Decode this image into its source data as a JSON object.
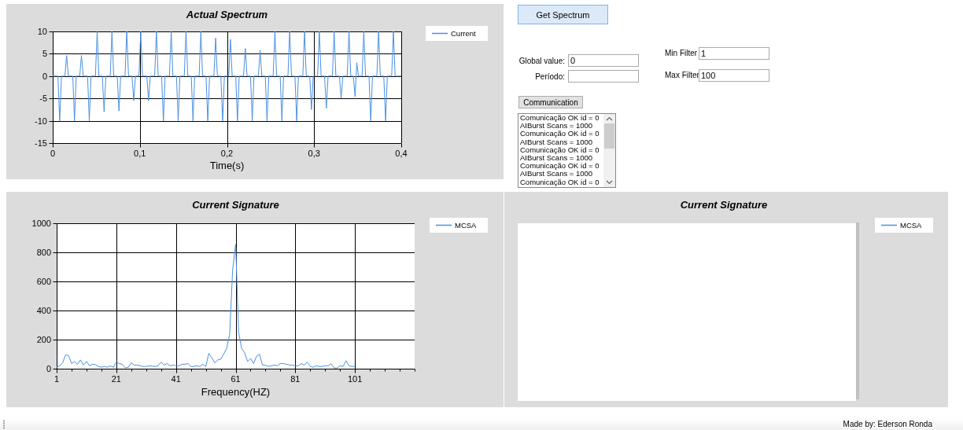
{
  "spectrum_chart": {
    "chart_data": {
      "type": "line",
      "title": "Actual Spectrum",
      "xlabel": "Time(s)",
      "x": [
        0,
        0.006,
        0.008,
        0.01,
        0.014,
        0.016,
        0.018,
        0.023,
        0.025,
        0.027,
        0.031,
        0.033,
        0.035,
        0.04,
        0.042,
        0.044,
        0.049,
        0.051,
        0.053,
        0.057,
        0.059,
        0.061,
        0.066,
        0.068,
        0.07,
        0.074,
        0.076,
        0.078,
        0.083,
        0.085,
        0.087,
        0.091,
        0.093,
        0.095,
        0.099,
        0.101,
        0.103,
        0.108,
        0.11,
        0.112,
        0.117,
        0.119,
        0.121,
        0.125,
        0.127,
        0.129,
        0.134,
        0.136,
        0.138,
        0.142,
        0.144,
        0.146,
        0.151,
        0.153,
        0.155,
        0.159,
        0.161,
        0.163,
        0.168,
        0.17,
        0.172,
        0.176,
        0.178,
        0.18,
        0.185,
        0.187,
        0.189,
        0.193,
        0.195,
        0.197,
        0.202,
        0.204,
        0.206,
        0.21,
        0.212,
        0.214,
        0.219,
        0.221,
        0.223,
        0.227,
        0.229,
        0.231,
        0.236,
        0.238,
        0.24,
        0.244,
        0.246,
        0.248,
        0.253,
        0.255,
        0.257,
        0.261,
        0.263,
        0.265,
        0.27,
        0.272,
        0.274,
        0.278,
        0.28,
        0.282,
        0.287,
        0.289,
        0.291,
        0.295,
        0.297,
        0.299,
        0.304,
        0.306,
        0.308,
        0.312,
        0.314,
        0.316,
        0.321,
        0.323,
        0.325,
        0.329,
        0.331,
        0.333,
        0.338,
        0.34,
        0.342,
        0.345,
        0.347,
        0.349,
        0.351,
        0.355,
        0.357,
        0.359,
        0.363,
        0.365,
        0.367,
        0.372,
        0.374,
        0.376,
        0.38,
        0.382,
        0.384,
        0.389,
        0.391,
        0.393,
        0.4
      ],
      "series": [
        {
          "name": "Current",
          "color": "#4a90e2",
          "values": [
            0,
            0,
            -10,
            0,
            0,
            4.6,
            0,
            0,
            -10,
            0,
            0,
            4.6,
            0,
            0,
            -10,
            0,
            0,
            10,
            0,
            0,
            -8,
            0,
            0,
            10,
            0,
            0,
            -7.8,
            0,
            0,
            10,
            0,
            0,
            -5.5,
            0,
            0,
            10,
            0,
            0,
            -5.5,
            0,
            0,
            10,
            0,
            0,
            -10,
            0,
            0,
            10,
            0,
            0,
            -10,
            0,
            0,
            10,
            0,
            0,
            -10,
            0,
            0,
            10,
            0,
            0,
            -10,
            0,
            0,
            8.5,
            0,
            0,
            -10,
            0,
            0,
            8.2,
            0,
            0,
            -10,
            0,
            0,
            6.2,
            0,
            0,
            -10,
            0,
            0,
            5.8,
            0,
            0,
            -10,
            0,
            0,
            10,
            0,
            0,
            -10,
            0,
            0,
            10,
            0,
            0,
            -10,
            0,
            0,
            10,
            0,
            0,
            -7.5,
            0,
            0,
            10,
            0,
            0,
            -7.2,
            0,
            0,
            10,
            0,
            0,
            -5,
            0,
            0,
            10,
            0,
            0,
            -4.6,
            3,
            0,
            0,
            10,
            0,
            0,
            -10,
            0,
            0,
            10,
            0,
            0,
            -10,
            0,
            0,
            10,
            0,
            0
          ]
        }
      ],
      "xlim": [
        0,
        0.4
      ],
      "ylim": [
        -15,
        10
      ],
      "xticks": [
        0,
        {
          "value": 0.1,
          "label": "0,1"
        },
        {
          "value": 0.2,
          "label": "0,2"
        },
        {
          "value": 0.3,
          "label": "0,3"
        },
        {
          "value": 0.4,
          "label": "0,4"
        }
      ],
      "yticks": [
        -15,
        -10,
        -5,
        0,
        5,
        10
      ],
      "grid": true
    }
  },
  "controls": {
    "get_spectrum_button": "Get Spectrum",
    "global_value": {
      "label": "Global value:",
      "value": "0"
    },
    "periodo": {
      "label": "Período:"
    },
    "min_filter": {
      "label": "Min Filter",
      "value": "1"
    },
    "max_filter": {
      "label": "Max Filter",
      "value": "100"
    },
    "communication_button": "Communication",
    "log": [
      "Comunicação OK id = 0",
      "AIBurst  Scans = 1000",
      "Comunicação OK id = 0",
      "AIBurst  Scans = 1000",
      "Comunicação OK id = 0",
      "AIBurst  Scans = 1000",
      "Comunicação OK id = 0",
      "AIBurst  Scans = 1000",
      "Comunicação OK id = 0"
    ]
  },
  "signature_chart": {
    "chart_data": {
      "type": "line",
      "title": "Current Signature",
      "xlabel": "Frequency(HZ)",
      "x": [
        1,
        2,
        3,
        4,
        5,
        6,
        7,
        8,
        9,
        10,
        11,
        12,
        13,
        14,
        15,
        16,
        17,
        18,
        19,
        20,
        21,
        22,
        23,
        24,
        25,
        26,
        27,
        28,
        29,
        30,
        31,
        32,
        33,
        34,
        35,
        36,
        37,
        38,
        39,
        40,
        41,
        42,
        43,
        44,
        45,
        46,
        47,
        48,
        49,
        50,
        51,
        52,
        53,
        54,
        55,
        56,
        57,
        58,
        59,
        60,
        61,
        62,
        63,
        64,
        65,
        66,
        67,
        68,
        69,
        70,
        71,
        72,
        73,
        74,
        75,
        76,
        77,
        78,
        79,
        80,
        81,
        82,
        83,
        84,
        85,
        86,
        87,
        88,
        89,
        90,
        91,
        92,
        93,
        94,
        95,
        96,
        97,
        98,
        99,
        100,
        101
      ],
      "series": [
        {
          "name": "MCSA",
          "color": "#4a90e2",
          "values": [
            10,
            20,
            40,
            95,
            90,
            35,
            50,
            30,
            60,
            25,
            50,
            20,
            30,
            28,
            15,
            10,
            15,
            10,
            20,
            10,
            45,
            35,
            30,
            5,
            10,
            40,
            25,
            25,
            20,
            15,
            15,
            20,
            18,
            15,
            20,
            45,
            25,
            35,
            20,
            25,
            20,
            20,
            30,
            30,
            35,
            15,
            15,
            20,
            15,
            30,
            15,
            105,
            75,
            40,
            60,
            65,
            100,
            140,
            235,
            680,
            855,
            250,
            140,
            110,
            50,
            70,
            35,
            85,
            100,
            25,
            25,
            15,
            20,
            25,
            20,
            35,
            35,
            30,
            25,
            25,
            20,
            20,
            35,
            25,
            45,
            15,
            10,
            20,
            15,
            15,
            20,
            20,
            35,
            5,
            5,
            20,
            15,
            55,
            20,
            15,
            15
          ]
        }
      ],
      "xlim": [
        1,
        121
      ],
      "ylim": [
        0,
        1000
      ],
      "xticks": [
        1,
        21,
        41,
        61,
        81,
        101
      ],
      "yticks": [
        0,
        200,
        400,
        600,
        800,
        1000
      ],
      "grid": true
    }
  },
  "signature_chart_empty": {
    "title": "Current Signature",
    "legend": "MCSA"
  },
  "status_bar": {
    "text": "Made by: Ederson Ronda"
  }
}
